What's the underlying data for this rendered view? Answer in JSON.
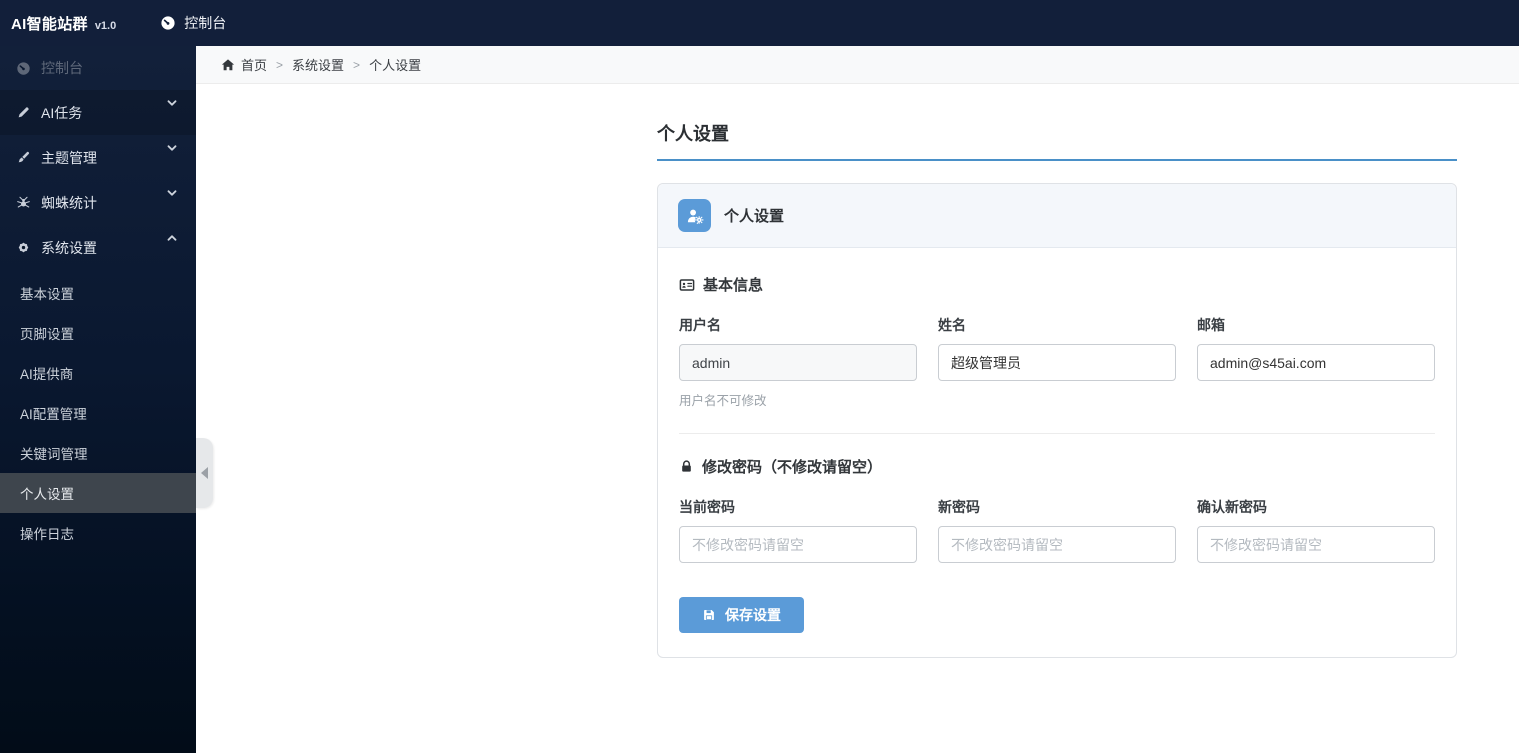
{
  "topbar": {
    "brand": "AI智能站群",
    "version": "v1.0",
    "console": "控制台"
  },
  "sidebar": {
    "items": [
      {
        "label": "控制台",
        "icon": "tachometer"
      },
      {
        "label": "AI任务",
        "icon": "pen"
      },
      {
        "label": "主题管理",
        "icon": "brush"
      },
      {
        "label": "蜘蛛统计",
        "icon": "spider"
      },
      {
        "label": "系统设置",
        "icon": "gear"
      }
    ],
    "submenu": [
      {
        "label": "基本设置"
      },
      {
        "label": "页脚设置"
      },
      {
        "label": "AI提供商"
      },
      {
        "label": "AI配置管理"
      },
      {
        "label": "关键词管理"
      },
      {
        "label": "个人设置"
      },
      {
        "label": "操作日志"
      }
    ]
  },
  "breadcrumb": {
    "home": "首页",
    "separator": ">",
    "section": "系统设置",
    "current": "个人设置"
  },
  "page": {
    "title": "个人设置"
  },
  "card": {
    "header_title": "个人设置",
    "basic": {
      "title": "基本信息",
      "username_label": "用户名",
      "username_value": "admin",
      "username_help": "用户名不可修改",
      "name_label": "姓名",
      "name_value": "超级管理员",
      "email_label": "邮箱",
      "email_value": "admin@s45ai.com"
    },
    "password": {
      "title": "修改密码（不修改请留空）",
      "current_label": "当前密码",
      "new_label": "新密码",
      "confirm_label": "确认新密码",
      "placeholder": "不修改密码请留空"
    },
    "save_label": "保存设置"
  },
  "colors": {
    "accent": "#5b9bd8",
    "title_underline": "#4a90c8",
    "topbar_bg": "#121f3a",
    "sidebar_active_bg": "#3e454d",
    "card_header_bg": "#f4f7fb"
  }
}
